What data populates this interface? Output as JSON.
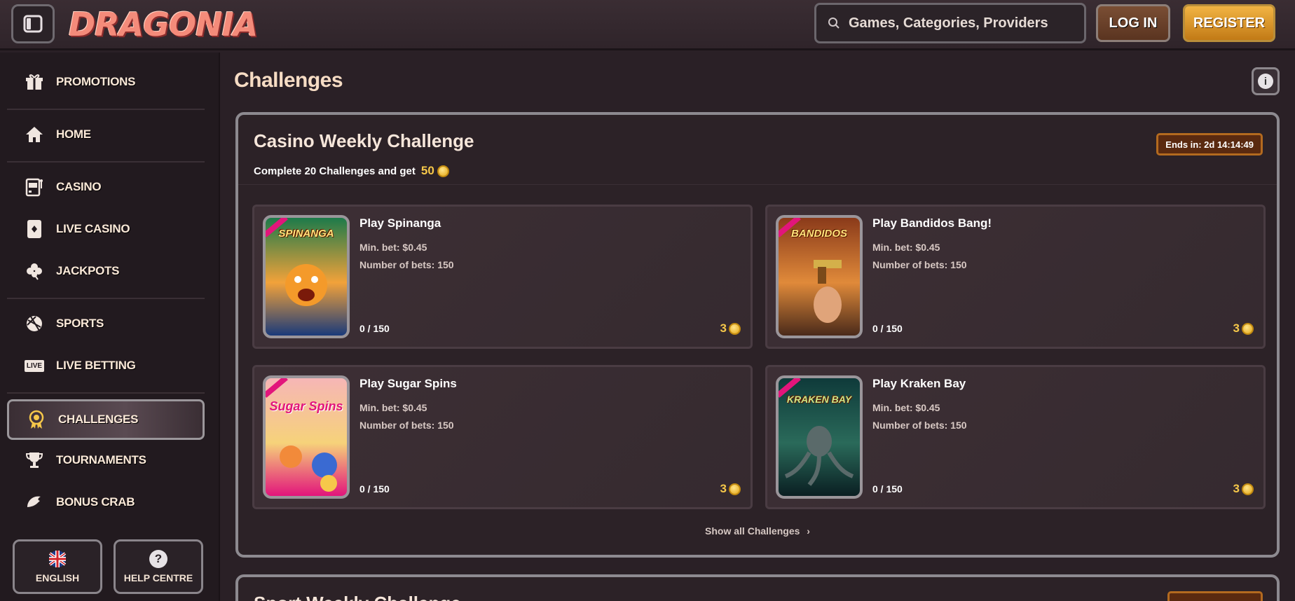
{
  "header": {
    "logo_text": "DRAGONIA",
    "search_placeholder": "Games, Categories, Providers",
    "login_label": "LOG IN",
    "register_label": "REGISTER"
  },
  "sidebar": {
    "items": [
      {
        "label": "PROMOTIONS",
        "icon": "gift-icon"
      },
      {
        "label": "HOME",
        "icon": "home-icon"
      },
      {
        "label": "CASINO",
        "icon": "slot-machine-icon"
      },
      {
        "label": "LIVE CASINO",
        "icon": "playing-card-icon"
      },
      {
        "label": "JACKPOTS",
        "icon": "clover-icon"
      },
      {
        "label": "SPORTS",
        "icon": "ball-icon"
      },
      {
        "label": "LIVE BETTING",
        "icon": "live-icon"
      },
      {
        "label": "CHALLENGES",
        "icon": "medal-icon"
      },
      {
        "label": "TOURNAMENTS",
        "icon": "trophy-icon"
      },
      {
        "label": "BONUS CRAB",
        "icon": "crab-icon"
      }
    ],
    "language_label": "ENGLISH",
    "help_label": "HELP CENTRE",
    "live_badge": "LIVE"
  },
  "main": {
    "title": "Challenges",
    "info_glyph": "i",
    "challenge": {
      "title": "Casino Weekly Challenge",
      "subtitle": "Complete 20 Challenges and get",
      "reward": "50",
      "ends": "Ends in: 2d 14:14:49",
      "cards": [
        {
          "name": "Play Spinanga",
          "thumb_text": "SPINANGA",
          "minbet": "Min. bet: $0.45",
          "nbets": "Number of bets: 150",
          "progress": "0 / 150",
          "points": "3",
          "colors": [
            "#1d7a4a",
            "#f2a23a",
            "#1a3a7a"
          ]
        },
        {
          "name": "Play Bandidos Bang!",
          "thumb_text": "BANDIDOS",
          "minbet": "Min. bet: $0.45",
          "nbets": "Number of bets: 150",
          "progress": "0 / 150",
          "points": "3",
          "colors": [
            "#8a3a1a",
            "#e08a3a",
            "#4a2a1a"
          ]
        },
        {
          "name": "Play Sugar Spins",
          "thumb_text": "Sugar Spins",
          "minbet": "Min. bet: $0.45",
          "nbets": "Number of bets: 150",
          "progress": "0 / 150",
          "points": "3",
          "colors": [
            "#f6b6b6",
            "#f6d27a",
            "#e2157b"
          ]
        },
        {
          "name": "Play Kraken Bay",
          "thumb_text": "KRAKEN BAY",
          "minbet": "Min. bet: $0.45",
          "nbets": "Number of bets: 150",
          "progress": "0 / 150",
          "points": "3",
          "colors": [
            "#0f3a3a",
            "#2a6a5a",
            "#0a1f22"
          ]
        }
      ],
      "show_all": "Show all Challenges"
    },
    "next_challenge_title": "Sport Weekly Challenge"
  }
}
